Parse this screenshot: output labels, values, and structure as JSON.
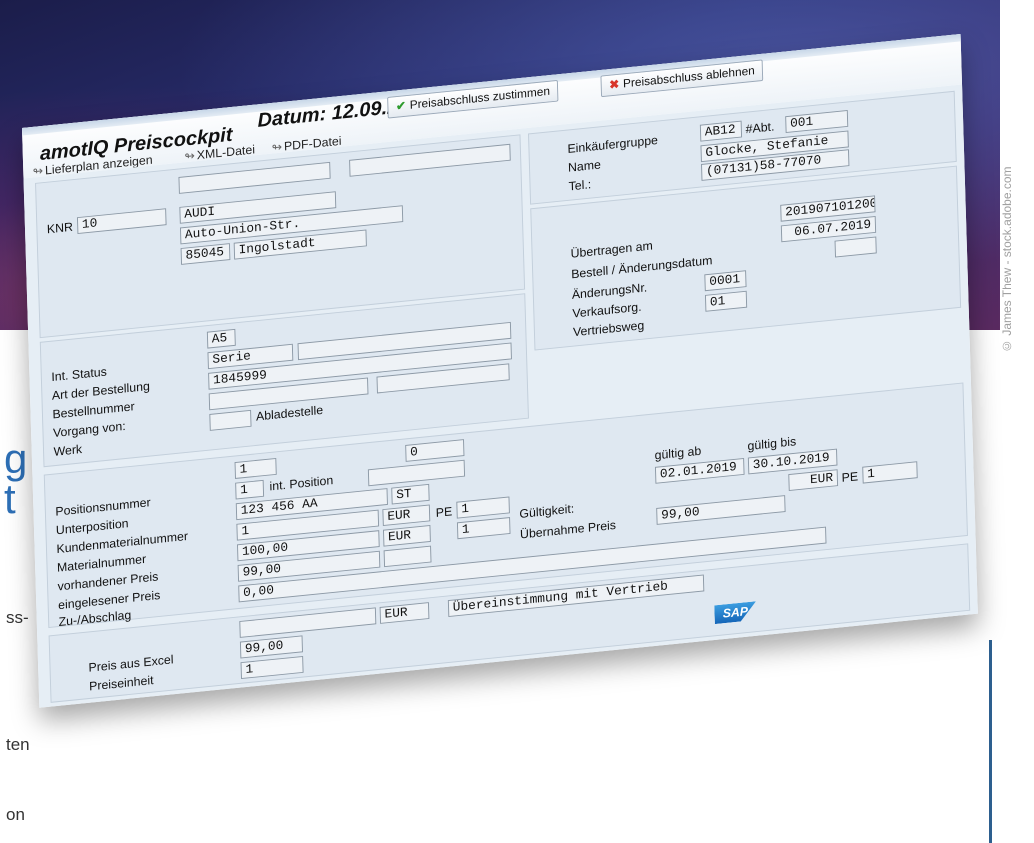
{
  "background": {
    "fragment_heading_1": "g",
    "fragment_heading_2": "t",
    "fragment_line_1": "ss-",
    "fragment_line_2": "ten",
    "fragment_line_3": "on",
    "credit": "© James Thew - stock.adobe.com"
  },
  "header": {
    "app_title": "amotIQ Preiscockpit",
    "date_label": "Datum: 12.09.2019",
    "approve_button": "Preisabschluss zustimmen",
    "reject_button": "Preisabschluss ablehnen",
    "link_lieferplan": "Lieferplan anzeigen",
    "link_xml": "XML-Datei",
    "link_pdf": "PDF-Datei"
  },
  "supplier": {
    "knr_label": "KNR",
    "knr_value": "10",
    "name": "AUDI",
    "street": "Auto-Union-Str.",
    "zip": "85045",
    "city": "Ingolstadt"
  },
  "buyer": {
    "group_label": "Einkäufergruppe",
    "group_value": "AB12",
    "dept_label": "#Abt.",
    "dept_value": "001",
    "name_label": "Name",
    "name_value": "Glocke, Stefanie",
    "tel_label": "Tel.:",
    "tel_value": "(07131)58-77070"
  },
  "transfer": {
    "uebertragen_label": "Übertragen am",
    "uebertragen_value": "201907101200",
    "bestell_label": "Bestell / Änderungsdatum",
    "bestell_value": "06.07.2019",
    "aenderung_label": "ÄnderungsNr.",
    "aenderung_value": "",
    "verkaufsorg_label": "Verkaufsorg.",
    "verkaufsorg_value": "0001",
    "vertriebsweg_label": "Vertriebsweg",
    "vertriebsweg_value": "01"
  },
  "order": {
    "int_status_label": "Int. Status",
    "int_status_value": "A5",
    "art_label": "Art der Bestellung",
    "art_value": "Serie",
    "bestellnummer_label": "Bestellnummer",
    "bestellnummer_value": "1845999",
    "vorgang_label": "Vorgang von:",
    "werk_label": "Werk",
    "abladestelle_label": "Abladestelle"
  },
  "position": {
    "positionsnummer_label": "Positionsnummer",
    "positionsnummer_value": "1",
    "int_position_label": "int. Position",
    "int_position_value": "0",
    "unterposition_label": "Unterposition",
    "unterposition_value": "1",
    "kundenmaterial_label": "Kundenmaterialnummer",
    "kundenmaterial_value": "123 456 AA",
    "kundenmaterial_unit": "ST",
    "materialnummer_label": "Materialnummer",
    "materialnummer_value": "1",
    "materialnummer_currency": "EUR",
    "pe_label_1": "PE",
    "pe_value_1": "1",
    "vorhanden_label": "vorhandener Preis",
    "vorhanden_value": "100,00",
    "vorhanden_currency": "EUR",
    "pe_value_2": "1",
    "eingelesen_label": "eingelesener Preis",
    "eingelesen_value": "99,00",
    "zuab_label": "Zu-/Abschlag",
    "zuab_value": "0,00"
  },
  "validity": {
    "gueltig_ab_label": "gültig ab",
    "gueltig_bis_label": "gültig bis",
    "gueltig_ab_value": "02.01.2019",
    "gueltig_bis_value": "30.10.2019",
    "gueltigkeit_label": "Gültigkeit:",
    "currency": "EUR",
    "pe_label": "PE",
    "pe_value": "1",
    "uebernahme_label": "Übernahme Preis",
    "uebernahme_value": "99,00"
  },
  "excel": {
    "preis_label": "Preis aus Excel",
    "preis_value": "99,00",
    "preis_currency": "EUR",
    "einheit_label": "Preiseinheit",
    "einheit_value": "1",
    "status_message": "Übereinstimmung  mit Vertrieb"
  },
  "footer": {
    "sap_logo": "SAP"
  }
}
